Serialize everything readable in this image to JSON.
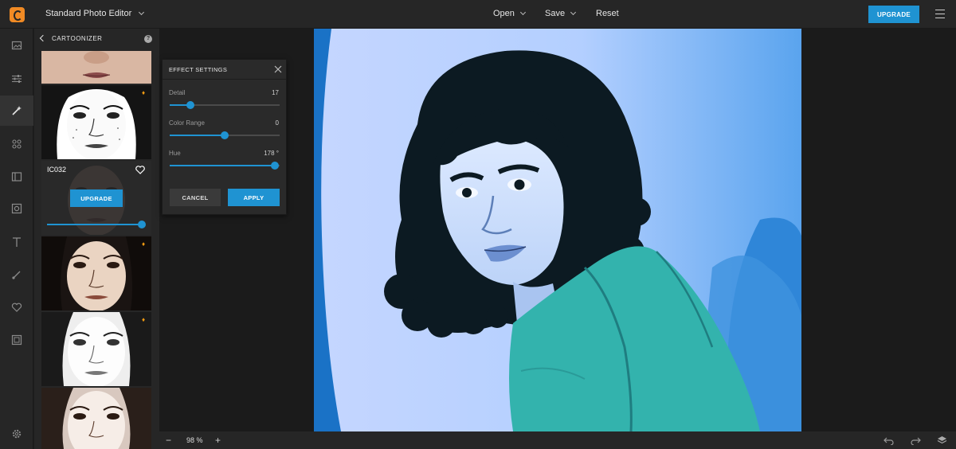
{
  "app": {
    "editor_mode": "Standard Photo Editor",
    "menu": {
      "open": "Open",
      "save": "Save",
      "reset": "Reset"
    },
    "upgrade_label": "UPGRADE"
  },
  "sidebar_icons": [
    "image-icon",
    "sliders-icon",
    "magic-wand-icon",
    "grid-icon",
    "frame-icon",
    "overlay-icon",
    "text-icon",
    "brush-icon",
    "heart-icon",
    "border-icon"
  ],
  "panel": {
    "title": "CARTOONIZER",
    "help": "?",
    "active_filter": {
      "name": "IC032",
      "upgrade_label": "UPGRADE",
      "intensity": 1.0
    }
  },
  "effect_settings": {
    "title": "EFFECT SETTINGS",
    "sliders": [
      {
        "label": "Detail",
        "value": "17",
        "fraction": 0.19
      },
      {
        "label": "Color Range",
        "value": "0",
        "fraction": 0.5
      },
      {
        "label": "Hue",
        "value": "178 °",
        "fraction": 0.96
      }
    ],
    "cancel_label": "CANCEL",
    "apply_label": "APPLY"
  },
  "zoom": {
    "value": "98 %",
    "minus": "−",
    "plus": "+"
  },
  "colors": {
    "accent": "#1f93d2",
    "logo": "#f08a24",
    "premium": "#f39c12"
  }
}
